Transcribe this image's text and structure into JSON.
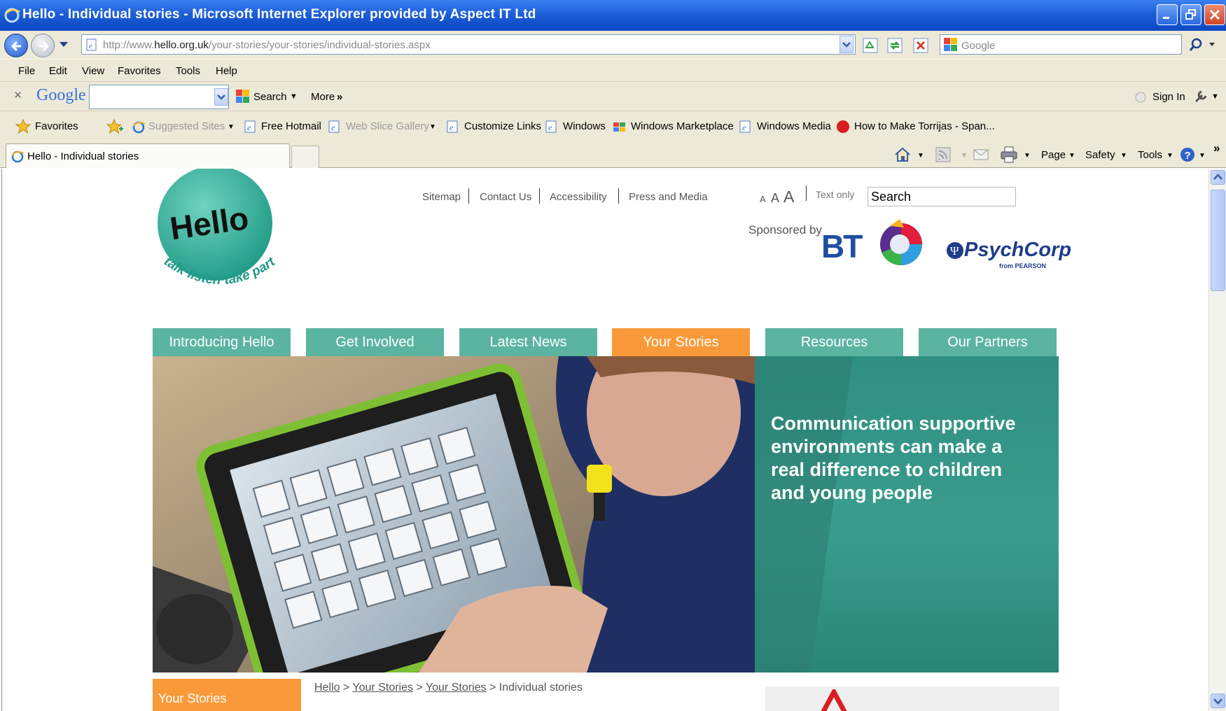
{
  "window": {
    "title": "Hello - Individual stories - Microsoft Internet Explorer provided by Aspect IT Ltd"
  },
  "address": {
    "url_prefix": "http://www.",
    "url_domain": "hello.org.uk",
    "url_path": "/your-stories/your-stories/individual-stories.aspx"
  },
  "search_engine": {
    "placeholder": "Google"
  },
  "menu": [
    "File",
    "Edit",
    "View",
    "Favorites",
    "Tools",
    "Help"
  ],
  "google_toolbar": {
    "logo": "Google",
    "search_label": "Search",
    "more_label": "More",
    "sign_in_label": "Sign In"
  },
  "favorites_bar": {
    "favorites_label": "Favorites",
    "items": [
      "Suggested Sites",
      "Free Hotmail",
      "Web Slice Gallery",
      "Customize Links",
      "Windows",
      "Windows Marketplace",
      "Windows Media",
      "How to Make Torrijas - Span..."
    ]
  },
  "tabs": {
    "active_label": "Hello - Individual stories"
  },
  "command_bar": {
    "page": "Page",
    "safety": "Safety",
    "tools": "Tools"
  },
  "site": {
    "top_links": [
      "Sitemap",
      "Contact Us",
      "Accessibility",
      "Press and Media"
    ],
    "text_size": [
      "A",
      "A",
      "A"
    ],
    "text_only": "Text only",
    "search_value": "Search",
    "sponsored_by": "Sponsored by",
    "sponsor1": "BT",
    "sponsor2": "PsychCorp",
    "sponsor2_sub": "from PEARSON",
    "logo_word": "Hello",
    "logo_tagline": "talk·listen·take part",
    "nav": [
      "Introducing Hello",
      "Get Involved",
      "Latest News",
      "Your Stories",
      "Resources",
      "Our Partners"
    ],
    "hero_text": "Communication supportive environments can make a real difference to children and young people",
    "side_heading": "Your Stories",
    "breadcrumb": {
      "items": [
        "Hello",
        "Your Stories",
        "Your Stories"
      ],
      "current": "Individual stories",
      "separator": ">"
    }
  },
  "colors": {
    "nav_teal": "#5bb4a0",
    "nav_active": "#f89a3a",
    "hero_teal": "#2f8f80",
    "titlebar": "#0b47c2"
  }
}
